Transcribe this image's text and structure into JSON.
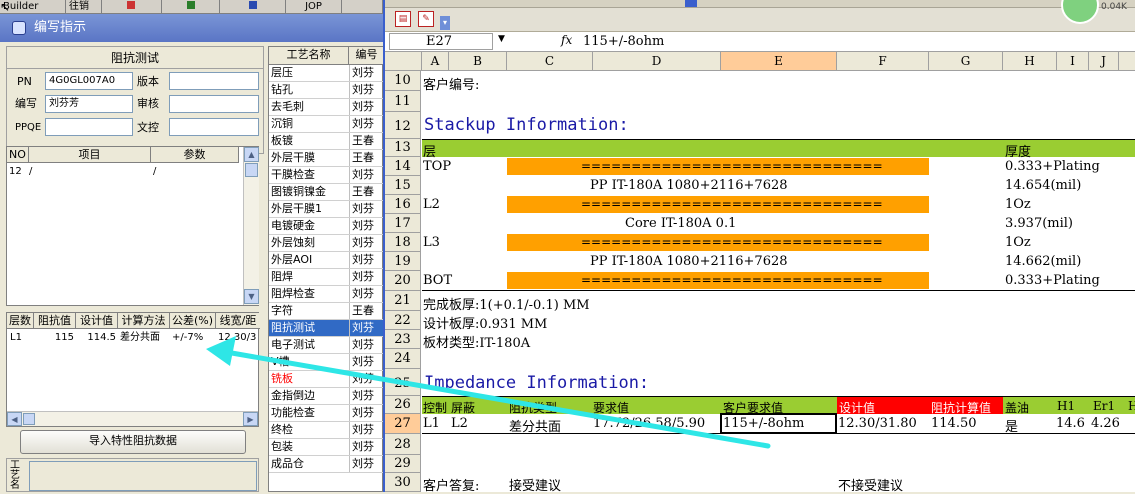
{
  "legacy_toolbar": {
    "items": [
      "Builder",
      "往销",
      "",
      "",
      "",
      "JOP",
      ""
    ]
  },
  "dialog": {
    "title": "编写指示",
    "group_title": "阻抗测试",
    "pn_label": "PN",
    "pn_value": "4G0GL007A0",
    "version_label": "版本",
    "author_label": "编写",
    "author_value": "刘芬芳",
    "reviewer_label": "审核",
    "ppqe_label": "PPQE",
    "control_label": "文控",
    "items_grid": {
      "headers": [
        "NO",
        "项目",
        "参数"
      ],
      "rows": [
        {
          "no": "12",
          "item": "/",
          "param": "/"
        }
      ]
    },
    "imp_grid": {
      "headers": [
        "层数",
        "阻抗值",
        "设计值",
        "计算方法",
        "公差(%)",
        "线宽/距"
      ],
      "rows": [
        {
          "layer": "L1",
          "imp": "115",
          "design": "114.5",
          "method": "差分共面",
          "tol": "+/-7%",
          "width": "12.30/3"
        }
      ]
    },
    "import_button": "导入特性阻抗数据",
    "remark_label": "工艺名"
  },
  "process_list": {
    "headers": [
      "工艺名称",
      "编号"
    ],
    "rows": [
      {
        "name": "层压",
        "owner": "刘芬"
      },
      {
        "name": "钻孔",
        "owner": "刘芬"
      },
      {
        "name": "去毛刺",
        "owner": "刘芬"
      },
      {
        "name": "沉铜",
        "owner": "刘芬"
      },
      {
        "name": "板镀",
        "owner": "王春"
      },
      {
        "name": "外层干膜",
        "owner": "王春"
      },
      {
        "name": "干膜检查",
        "owner": "刘芬"
      },
      {
        "name": "图镀铜镍金",
        "owner": "王春"
      },
      {
        "name": "外层干膜1",
        "owner": "刘芬"
      },
      {
        "name": "电镀硬金",
        "owner": "刘芬"
      },
      {
        "name": "外层蚀刻",
        "owner": "刘芬"
      },
      {
        "name": "外层AOI",
        "owner": "刘芬"
      },
      {
        "name": "阻焊",
        "owner": "刘芬"
      },
      {
        "name": "阻焊检查",
        "owner": "刘芬"
      },
      {
        "name": "字符",
        "owner": "王春"
      },
      {
        "name": "阻抗测试",
        "owner": "刘芬"
      },
      {
        "name": "电子测试",
        "owner": "刘芬"
      },
      {
        "name": "V槽",
        "owner": "刘芬"
      },
      {
        "name": "铣板",
        "owner": "刘芬"
      },
      {
        "name": "金指倒边",
        "owner": "刘芬"
      },
      {
        "name": "功能检查",
        "owner": "刘芬"
      },
      {
        "name": "终检",
        "owner": "刘芬"
      },
      {
        "name": "包装",
        "owner": "刘芬"
      },
      {
        "name": "成品仓",
        "owner": "刘芬"
      }
    ],
    "selected_index": 15,
    "red_index": 18
  },
  "excel": {
    "name_box": "E27",
    "fx": "fx",
    "formula": "115+/-8ohm",
    "columns": [
      "A",
      "B",
      "C",
      "D",
      "E",
      "F",
      "G",
      "H",
      "I",
      "J"
    ],
    "rows": [
      "10",
      "11",
      "12",
      "13",
      "14",
      "15",
      "16",
      "17",
      "18",
      "19",
      "20",
      "21",
      "22",
      "23",
      "24",
      "25",
      "26",
      "27",
      "28",
      "29",
      "30"
    ],
    "customer_no": "客户编号:",
    "stackup_title": "Stackup Information:",
    "layer_header": "层",
    "thickness_header": "厚度",
    "top_label": "TOP",
    "l2_label": "L2",
    "l3_label": "L3",
    "bot_label": "BOT",
    "dashes": "==============================",
    "pp1": "PP      IT-180A     1080+2116+7628",
    "core": "Core     IT-180A     0.1",
    "pp2": "PP      IT-180A     1080+2116+7628",
    "th14": "0.333+Plating",
    "th15": "14.654(mil)",
    "th16": "1Oz",
    "th17": "3.937(mil)",
    "th18": "1Oz",
    "th19": "14.662(mil)",
    "th20": "0.333+Plating",
    "finish_thk": "完成板厚:1(+0.1/-0.1) MM",
    "design_thk": "设计板厚:0.931 MM",
    "material": "板材类型:IT-180A",
    "impedance_title": "Impedance Information:",
    "imp_headers": {
      "ctrl": "控制",
      "shield": "屏蔽",
      "type": "阻抗类型",
      "req": "要求值",
      "cust": "客户要求值",
      "design": "设计值",
      "calc": "阻抗计算值",
      "oil": "盖油",
      "h1": "H1",
      "er1": "Er1",
      "h": "H"
    },
    "imp_row": {
      "ctrl": "L1",
      "shield": "L2",
      "type": "差分共面",
      "req": "17.72/26.58/5.90",
      "cust": "115+/-8ohm",
      "design": "12.30/31.80",
      "calc": "114.50",
      "oil": "是",
      "h1": "14.6",
      "er1": "4.26"
    },
    "reply_label": "客户答复:",
    "accept": "接受建议",
    "reject": "不接受建议",
    "badge": "0.04K"
  },
  "colors": {
    "green": "#9acd32",
    "orange": "#ffa000",
    "red": "#ff0000",
    "title": "#1a1aa6",
    "arrow": "#2ee6e6",
    "selected": "#316ac5"
  }
}
